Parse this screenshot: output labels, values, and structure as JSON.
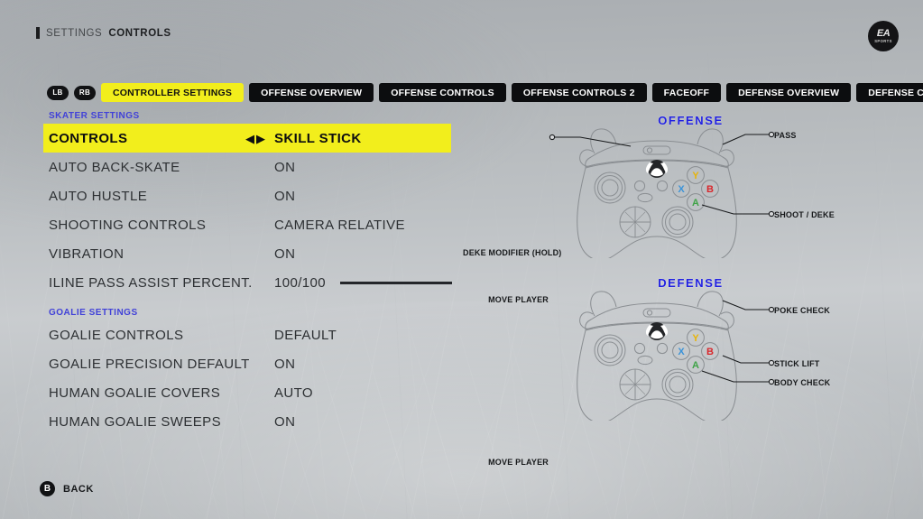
{
  "header": {
    "breadcrumb_marker": "bar",
    "breadcrumb_parent": "SETTINGS",
    "breadcrumb_current": "CONTROLS",
    "logo_primary": "EA",
    "logo_secondary": "SPORTS"
  },
  "tabbar": {
    "bumper_left": "LB",
    "bumper_right": "RB",
    "tabs": [
      {
        "label": "CONTROLLER SETTINGS",
        "active": true
      },
      {
        "label": "OFFENSE OVERVIEW",
        "active": false
      },
      {
        "label": "OFFENSE CONTROLS",
        "active": false
      },
      {
        "label": "OFFENSE CONTROLS 2",
        "active": false
      },
      {
        "label": "FACEOFF",
        "active": false
      },
      {
        "label": "DEFENSE OVERVIEW",
        "active": false
      },
      {
        "label": "DEFENSE CONTROLS",
        "active": false
      }
    ]
  },
  "settings": {
    "skater_section_label": "SKATER SETTINGS",
    "goalie_section_label": "GOALIE SETTINGS",
    "arrow_left": "◀",
    "arrow_right": "▶",
    "skater_rows": [
      {
        "label": "CONTROLS",
        "value": "SKILL STICK",
        "highlight": true,
        "arrows": true
      },
      {
        "label": "AUTO BACK-SKATE",
        "value": "ON"
      },
      {
        "label": "AUTO HUSTLE",
        "value": "ON"
      },
      {
        "label": "SHOOTING CONTROLS",
        "value": "CAMERA RELATIVE"
      },
      {
        "label": "VIBRATION",
        "value": "ON"
      },
      {
        "label": "ILINE PASS ASSIST PERCENT.",
        "value": "100/100",
        "slider": 100
      }
    ],
    "goalie_rows": [
      {
        "label": "GOALIE CONTROLS",
        "value": "DEFAULT"
      },
      {
        "label": "GOALIE PRECISION DEFAULT",
        "value": "ON"
      },
      {
        "label": "HUMAN GOALIE COVERS",
        "value": "AUTO"
      },
      {
        "label": "HUMAN GOALIE SWEEPS",
        "value": "ON"
      }
    ]
  },
  "diagrams": {
    "offense": {
      "title": "OFFENSE",
      "labels": {
        "deke_modifier": "DEKE MODIFIER (HOLD)",
        "pass": "PASS",
        "move_player": "MOVE PLAYER",
        "shoot_deke": "SHOOT / DEKE"
      }
    },
    "defense": {
      "title": "DEFENSE",
      "labels": {
        "poke_check": "POKE CHECK",
        "move_player": "MOVE PLAYER",
        "stick_lift": "STICK LIFT",
        "body_check": "BODY CHECK"
      }
    },
    "face_buttons": {
      "y": "Y",
      "x": "X",
      "b": "B",
      "a": "A"
    },
    "colors": {
      "button_y": "#e8b407",
      "button_x": "#3b93d8",
      "button_b": "#d8262b",
      "button_a": "#3fa347",
      "title": "#2020e0"
    }
  },
  "footer": {
    "button": "B",
    "label": "BACK"
  },
  "theme": {
    "accent_yellow": "#f2ee1c",
    "section_blue": "#4141d8",
    "tab_black": "#0c0d0f"
  }
}
